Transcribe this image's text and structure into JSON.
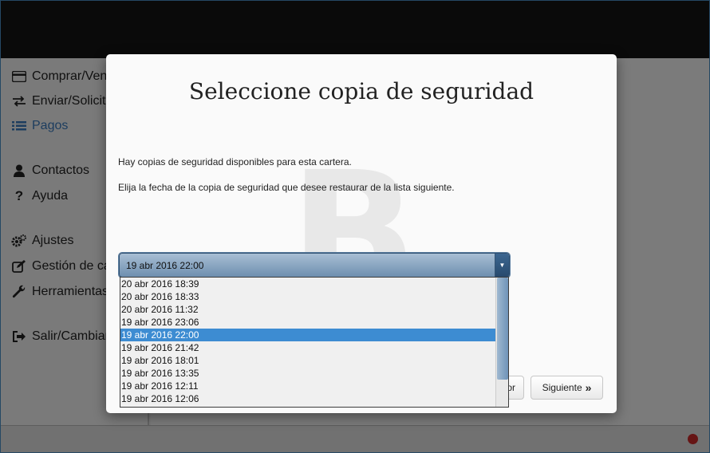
{
  "sidebar": {
    "items": [
      {
        "label": "Comprar/Vender",
        "icon": "credit-card-icon"
      },
      {
        "label": "Enviar/Solicitar",
        "icon": "exchange-icon"
      },
      {
        "label": "Pagos",
        "icon": "list-icon",
        "active": true
      },
      {
        "label": "Contactos",
        "icon": "user-icon"
      },
      {
        "label": "Ayuda",
        "icon": "question-icon"
      },
      {
        "label": "Ajustes",
        "icon": "gears-icon"
      },
      {
        "label": "Gestión de cartera",
        "icon": "edit-icon"
      },
      {
        "label": "Herramientas",
        "icon": "wrench-icon"
      },
      {
        "label": "Salir/Cambiar",
        "icon": "sign-out-icon"
      }
    ]
  },
  "modal": {
    "title": "Seleccione copia de seguridad",
    "text1": "Hay copias de seguridad disponibles para esta cartera.",
    "text2": "Elija la fecha de la copia de seguridad que desee restaurar de la lista siguiente.",
    "watermark_glyph": "B",
    "select": {
      "value": "19 abr 2016 22:00",
      "options": [
        "20 abr 2016 18:39",
        "20 abr 2016 18:33",
        "20 abr 2016 11:32",
        "19 abr 2016 23:06",
        "19 abr 2016 22:00",
        "19 abr 2016 21:42",
        "19 abr 2016 18:01",
        "19 abr 2016 13:35",
        "19 abr 2016 12:11",
        "19 abr 2016 12:06"
      ],
      "selected_index": 4
    },
    "back_label": "or",
    "next_label": "Siguiente",
    "next_icon": "double-chevron-right-icon"
  },
  "colors": {
    "accent": "#3a7bbf",
    "selection": "#3d8cd2",
    "status_dot": "#cc2a2a"
  }
}
